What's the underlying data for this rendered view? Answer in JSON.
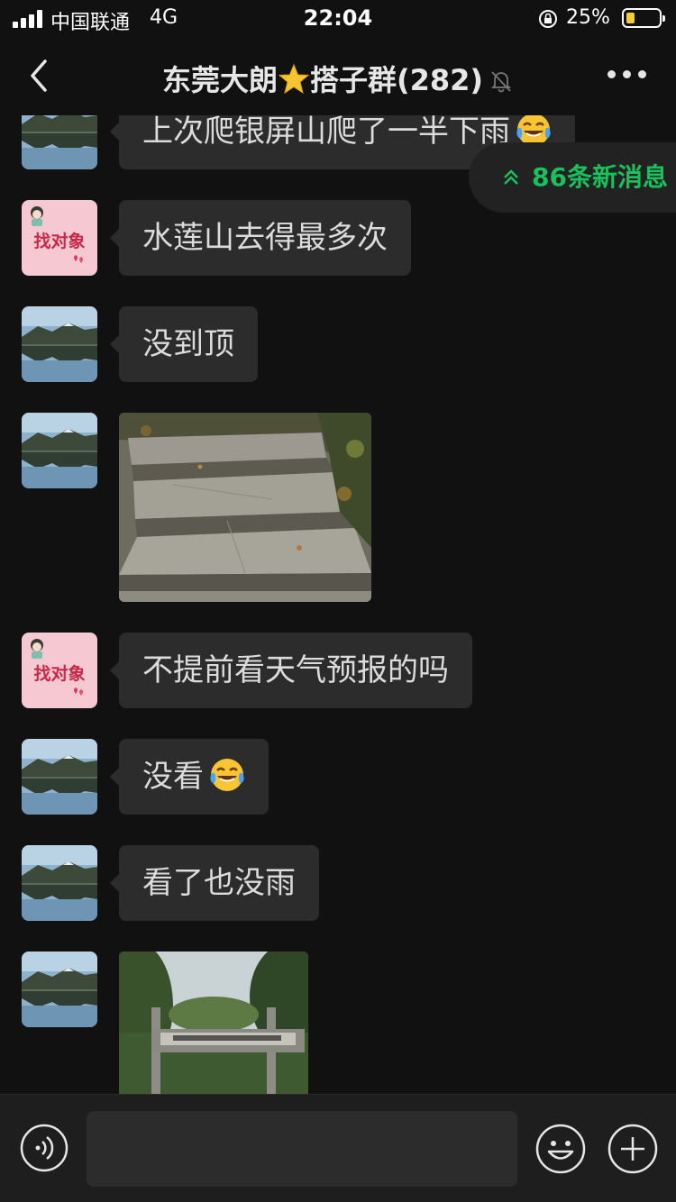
{
  "status_bar": {
    "carrier": "中国联通",
    "network": "4G",
    "time": "22:04",
    "battery": "25%",
    "battery_level": 0.25
  },
  "nav": {
    "title_before_star": "东莞大朗",
    "title_after_star": "搭子群(282)",
    "icons": [
      "back-icon",
      "star-icon",
      "mute-bell-icon",
      "more-icon"
    ]
  },
  "new_messages": {
    "label": "86条新消息",
    "icon": "double-chevron-up-icon"
  },
  "messages": [
    {
      "text": "上次爬银屏山爬了一半下雨",
      "emoji": "laughing-crying-emoji",
      "avatar": "lake-avatar"
    },
    {
      "text": "水莲山去得最多次",
      "avatar": "find-partner-avatar",
      "avatar_text": "找对象"
    },
    {
      "text": "没到顶",
      "avatar": "lake-avatar"
    },
    {
      "type": "photo",
      "description_icon": "stone-steps-photo",
      "avatar": "lake-avatar"
    },
    {
      "text": "不提前看天气预报的吗",
      "avatar": "find-partner-avatar",
      "avatar_text": "找对象"
    },
    {
      "text": "没看",
      "emoji": "laughing-crying-emoji",
      "avatar": "lake-avatar"
    },
    {
      "text": "看了也没雨",
      "avatar": "lake-avatar"
    },
    {
      "type": "photo",
      "description_icon": "park-gate-photo",
      "avatar": "lake-avatar"
    }
  ],
  "input_bar": {
    "placeholder": "",
    "icons": [
      "voice-icon",
      "emoji-icon",
      "plus-icon"
    ]
  },
  "colors": {
    "background": "#111111",
    "bubble": "#2c2c2c",
    "accent_green": "#1bbf5c",
    "battery_yellow": "#f7ce32"
  }
}
